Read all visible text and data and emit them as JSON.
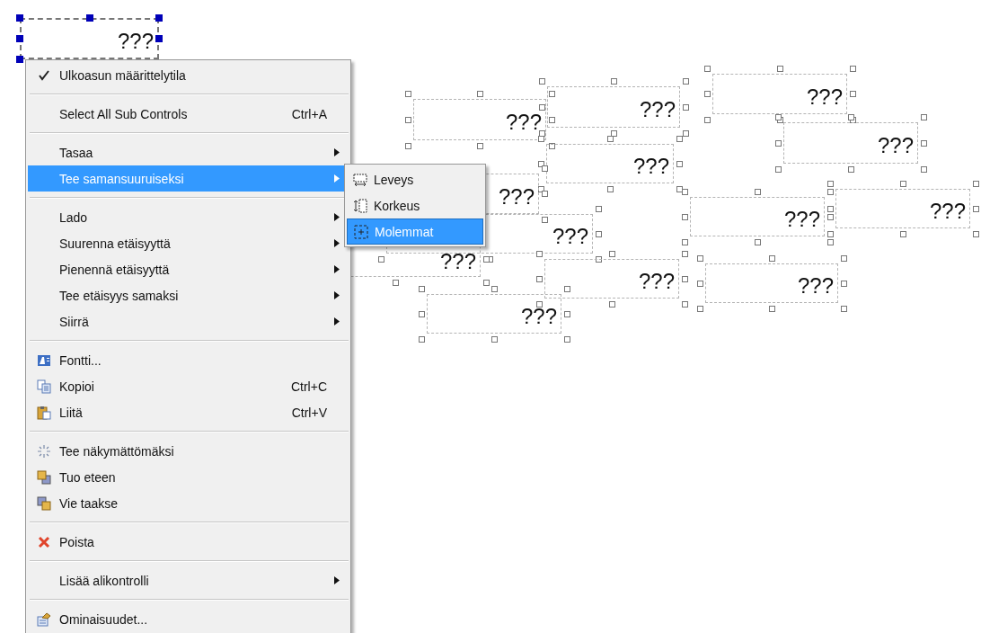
{
  "canvas": {
    "controls": [
      {
        "text": "???",
        "selected": true
      },
      {
        "text": "???",
        "selected": false
      },
      {
        "text": "???",
        "selected": false
      },
      {
        "text": "???",
        "selected": false
      },
      {
        "text": "???",
        "selected": false
      },
      {
        "text": "???",
        "selected": false
      },
      {
        "text": "???",
        "selected": false
      },
      {
        "text": "???",
        "selected": false
      },
      {
        "text": "???",
        "selected": false
      },
      {
        "text": "???",
        "selected": false
      },
      {
        "text": "???",
        "selected": false
      },
      {
        "text": "???",
        "selected": false
      },
      {
        "text": "???",
        "selected": false
      },
      {
        "text": "???",
        "selected": false
      }
    ]
  },
  "context_menu": {
    "items": [
      {
        "kind": "item",
        "label": "Ulkoasun määrittelytila",
        "checked": true,
        "has_submenu": false,
        "selected": false
      },
      {
        "kind": "separator"
      },
      {
        "kind": "item",
        "label": "Select All Sub Controls",
        "shortcut": "Ctrl+A",
        "checked": false,
        "has_submenu": false,
        "selected": false
      },
      {
        "kind": "separator"
      },
      {
        "kind": "item",
        "label": "Tasaa",
        "checked": false,
        "has_submenu": true,
        "selected": false
      },
      {
        "kind": "item",
        "label": "Tee samansuuruiseksi",
        "checked": false,
        "has_submenu": true,
        "selected": true
      },
      {
        "kind": "separator"
      },
      {
        "kind": "item",
        "label": "Lado",
        "checked": false,
        "has_submenu": true,
        "selected": false
      },
      {
        "kind": "item",
        "label": "Suurenna etäisyyttä",
        "checked": false,
        "has_submenu": true,
        "selected": false
      },
      {
        "kind": "item",
        "label": "Pienennä etäisyyttä",
        "checked": false,
        "has_submenu": true,
        "selected": false
      },
      {
        "kind": "item",
        "label": "Tee etäisyys samaksi",
        "checked": false,
        "has_submenu": true,
        "selected": false
      },
      {
        "kind": "item",
        "label": "Siirrä",
        "checked": false,
        "has_submenu": true,
        "selected": false
      },
      {
        "kind": "separator"
      },
      {
        "kind": "item",
        "label": "Fontti...",
        "checked": false,
        "has_submenu": false,
        "selected": false
      },
      {
        "kind": "item",
        "label": "Kopioi",
        "shortcut": "Ctrl+C",
        "checked": false,
        "has_submenu": false,
        "selected": false
      },
      {
        "kind": "item",
        "label": "Liitä",
        "shortcut": "Ctrl+V",
        "checked": false,
        "has_submenu": false,
        "selected": false
      },
      {
        "kind": "separator"
      },
      {
        "kind": "item",
        "label": "Tee näkymättömäksi",
        "checked": false,
        "has_submenu": false,
        "selected": false
      },
      {
        "kind": "item",
        "label": "Tuo eteen",
        "checked": false,
        "has_submenu": false,
        "selected": false
      },
      {
        "kind": "item",
        "label": "Vie taakse",
        "checked": false,
        "has_submenu": false,
        "selected": false
      },
      {
        "kind": "separator"
      },
      {
        "kind": "item",
        "label": "Poista",
        "checked": false,
        "has_submenu": false,
        "selected": false
      },
      {
        "kind": "separator"
      },
      {
        "kind": "item",
        "label": "Lisää alikontrolli",
        "checked": false,
        "has_submenu": true,
        "selected": false
      },
      {
        "kind": "separator"
      },
      {
        "kind": "item",
        "label": "Ominaisuudet...",
        "checked": false,
        "has_submenu": false,
        "selected": false
      }
    ]
  },
  "submenu": {
    "items": [
      {
        "label": "Leveys",
        "selected": false
      },
      {
        "label": "Korkeus",
        "selected": false
      },
      {
        "label": "Molemmat",
        "selected": true
      }
    ]
  }
}
